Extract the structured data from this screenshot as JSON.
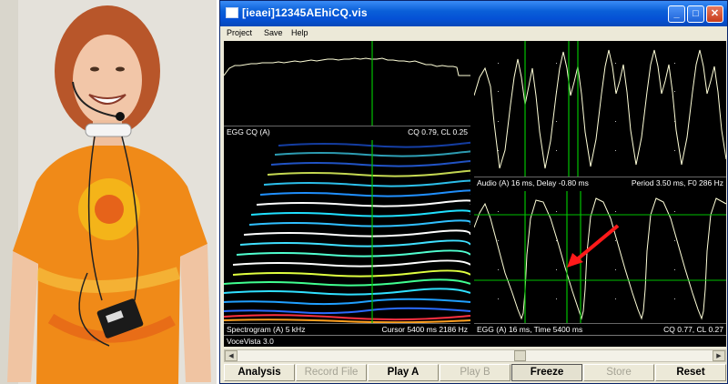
{
  "window": {
    "title": "[ieaei]12345AEhiCQ.vis",
    "controls": {
      "minimize": "_",
      "maximize": "□",
      "close": "✕"
    }
  },
  "menu": [
    "Project",
    "Save",
    "Help"
  ],
  "panels": {
    "egg_cq": {
      "left": "EGG CQ (A)",
      "right": "CQ 0.79, CL 0.25"
    },
    "audio": {
      "left": "Audio (A) 16 ms, Delay -0.80 ms",
      "right": "Period 3.50 ms, F0 286 Hz"
    },
    "spectrogram": {
      "left": "Spectrogram (A)  5 kHz",
      "right": "Cursor  5400 ms  2186 Hz"
    },
    "egg": {
      "left": "EGG (A) 16 ms, Time 5400 ms",
      "right": "CQ 0.77, CL 0.27"
    }
  },
  "status": "VoceVista 3.0",
  "scrollbar": {
    "left_arrow": "◀",
    "right_arrow": "▶"
  },
  "buttons": [
    {
      "label": "Analysis",
      "enabled": true
    },
    {
      "label": "Record File",
      "enabled": false
    },
    {
      "label": "Play A",
      "enabled": true
    },
    {
      "label": "Play B",
      "enabled": false
    },
    {
      "label": "Freeze",
      "enabled": true
    },
    {
      "label": "Store",
      "enabled": false
    },
    {
      "label": "Reset",
      "enabled": true
    }
  ],
  "colors": {
    "trace": "#ffffd0",
    "cursor": "#00c000",
    "arrow": "#ff1a1a",
    "titlebar": "#0a5fd8"
  }
}
